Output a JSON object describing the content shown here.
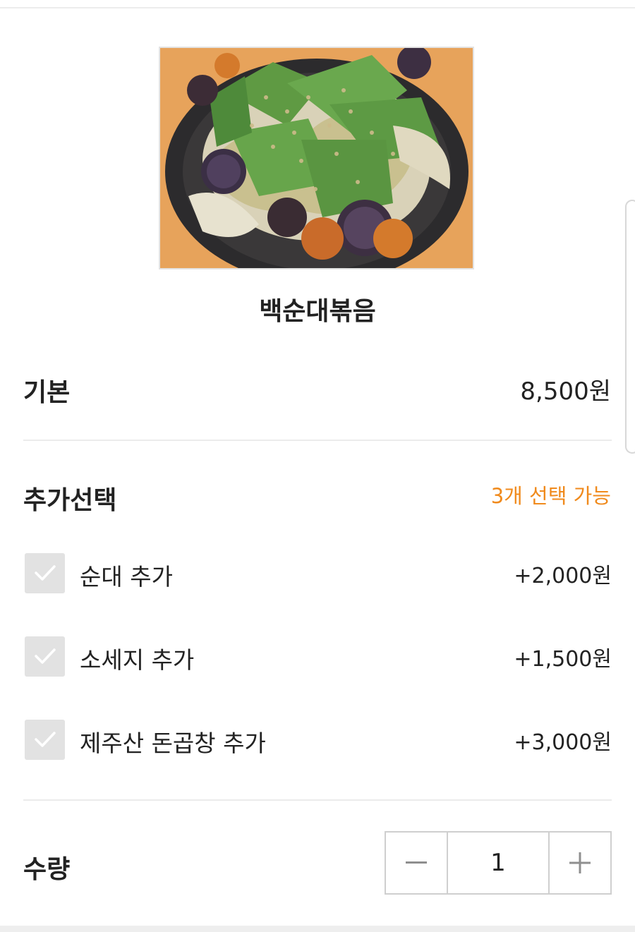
{
  "product": {
    "name": "백순대볶음",
    "image_alt": "백순대볶음 사진"
  },
  "base": {
    "label": "기본",
    "price": "8,500원"
  },
  "options": {
    "title": "추가선택",
    "hint": "3개 선택 가능",
    "hint_color": "#f08a1c",
    "items": [
      {
        "label": "순대 추가",
        "price": "+2,000원",
        "checked": false
      },
      {
        "label": "소세지 추가",
        "price": "+1,500원",
        "checked": false
      },
      {
        "label": "제주산 돈곱창 추가",
        "price": "+3,000원",
        "checked": false
      }
    ]
  },
  "quantity": {
    "label": "수량",
    "value": "1",
    "minus_icon": "minus-icon",
    "plus_icon": "plus-icon"
  }
}
